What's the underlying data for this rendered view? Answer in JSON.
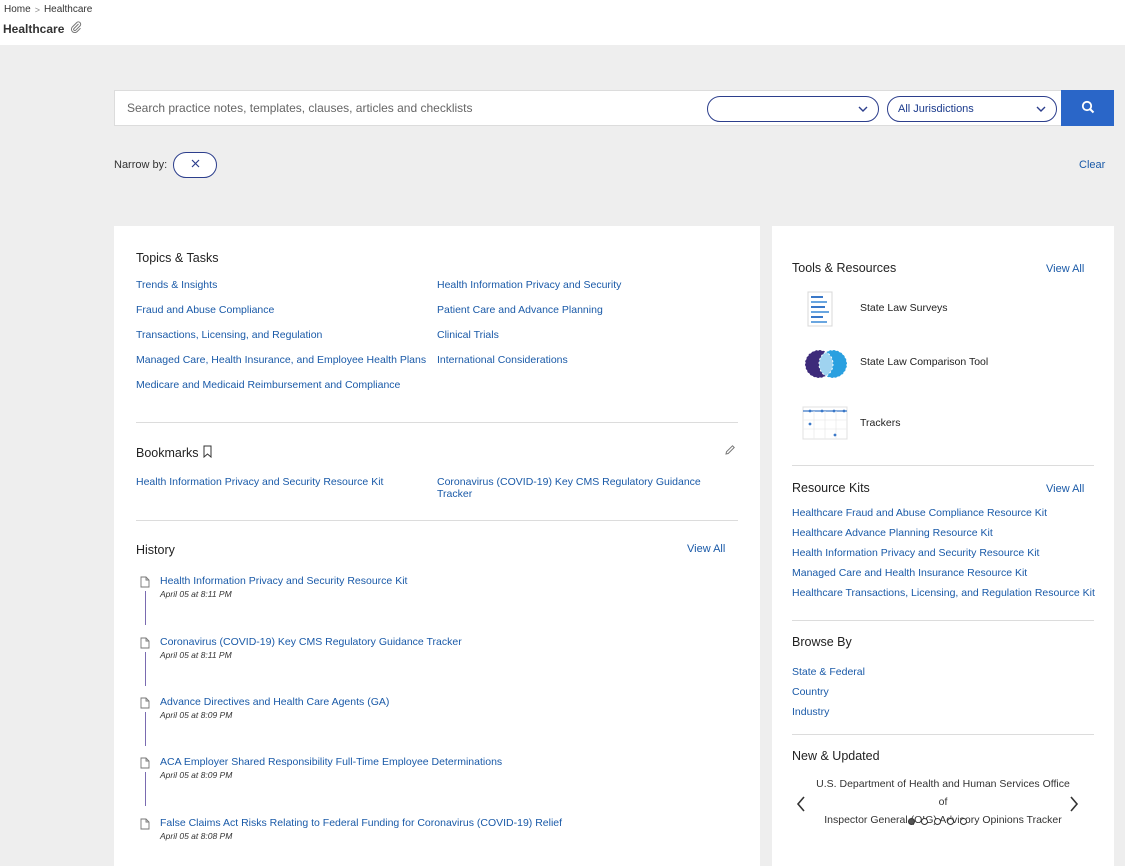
{
  "breadcrumb": {
    "home": "Home",
    "current": "Healthcare"
  },
  "page": {
    "title": "Healthcare"
  },
  "search": {
    "placeholder": "Search practice notes, templates, clauses, articles and checklists",
    "category_value": "",
    "jurisdiction_value": "All Jurisdictions"
  },
  "narrow": {
    "label": "Narrow by:",
    "clear": "Clear"
  },
  "topics": {
    "title": "Topics & Tasks",
    "left": [
      "Trends & Insights",
      "Fraud and Abuse Compliance",
      "Transactions, Licensing, and Regulation",
      "Managed Care, Health Insurance, and Employee Health Plans",
      "Medicare and Medicaid Reimbursement and Compliance"
    ],
    "right": [
      "Health Information Privacy and Security",
      "Patient Care and Advance Planning",
      "Clinical Trials",
      "International Considerations"
    ]
  },
  "bookmarks": {
    "title": "Bookmarks",
    "items": [
      "Health Information Privacy and Security Resource Kit",
      "Coronavirus (COVID-19) Key CMS Regulatory Guidance Tracker"
    ]
  },
  "history": {
    "title": "History",
    "view_all": "View All",
    "items": [
      {
        "title": "Health Information Privacy and Security Resource Kit",
        "time": "April 05 at 8:11 PM"
      },
      {
        "title": "Coronavirus (COVID-19) Key CMS Regulatory Guidance Tracker",
        "time": "April 05 at 8:11 PM"
      },
      {
        "title": "Advance Directives and Health Care Agents (GA)",
        "time": "April 05 at 8:09 PM"
      },
      {
        "title": "ACA Employer Shared Responsibility Full-Time Employee Determinations",
        "time": "April 05 at 8:09 PM"
      },
      {
        "title": "False Claims Act Risks Relating to Federal Funding for Coronavirus (COVID-19) Relief",
        "time": "April 05 at 8:08 PM"
      }
    ]
  },
  "tools": {
    "title": "Tools & Resources",
    "view_all": "View All",
    "items": [
      {
        "label": "State Law Surveys",
        "icon": "document-lines-icon"
      },
      {
        "label": "State Law Comparison Tool",
        "icon": "venn-circles-icon"
      },
      {
        "label": "Trackers",
        "icon": "calendar-grid-icon"
      }
    ]
  },
  "resource_kits": {
    "title": "Resource Kits",
    "view_all": "View All",
    "items": [
      "Healthcare Fraud and Abuse Compliance Resource Kit",
      "Healthcare Advance Planning Resource Kit",
      "Health Information Privacy and Security Resource Kit",
      "Managed Care and Health Insurance Resource Kit",
      "Healthcare Transactions, Licensing, and Regulation Resource Kit"
    ]
  },
  "browse_by": {
    "title": "Browse By",
    "items": [
      "State & Federal",
      "Country",
      "Industry"
    ]
  },
  "new_updated": {
    "title": "New & Updated",
    "line1": "U.S. Department of Health and Human Services Office of",
    "line2": "Inspector General (OIG) Advisory Opinions Tracker",
    "dot_count": 5,
    "active_dot": 1
  },
  "colors": {
    "link": "#1a5aa8",
    "accent": "#2a66c8",
    "pill_border": "#2c3e8c"
  }
}
